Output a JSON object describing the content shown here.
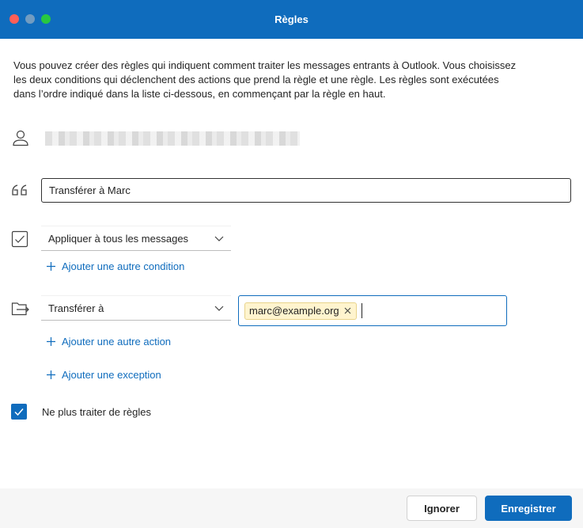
{
  "window": {
    "title": "Règles"
  },
  "intro": {
    "text": "Vous pouvez créer des règles qui indiquent comment traiter les messages entrants à Outlook. Vous choisissez les deux conditions qui déclenchent des actions que prend la règle et une règle. Les règles sont exécutées dans l’ordre indiqué dans la liste ci-dessous, en commençant par la règle en haut."
  },
  "rule": {
    "name_value": "Transférer à Marc",
    "condition_label": "Appliquer à tous les messages",
    "add_condition_label": "Ajouter une autre condition",
    "action_label": "Transférer à",
    "recipient": "marc@example.org",
    "add_action_label": "Ajouter une autre action",
    "add_exception_label": "Ajouter une exception",
    "stop_processing_label": "Ne plus traiter de règles",
    "stop_processing_checked": true
  },
  "footer": {
    "cancel_label": "Ignorer",
    "save_label": "Enregistrer"
  },
  "colors": {
    "accent": "#0f6cbd",
    "chip_bg": "#fff4ce",
    "footer_bg": "#f6f6f6"
  },
  "icons": {
    "account": "person-icon",
    "name": "quote-icon",
    "condition": "checkbox-outline-icon",
    "action": "forward-folder-icon",
    "dropdown": "chevron-down-icon",
    "add": "plus-icon",
    "remove": "close-icon",
    "checked": "checkmark-icon"
  }
}
